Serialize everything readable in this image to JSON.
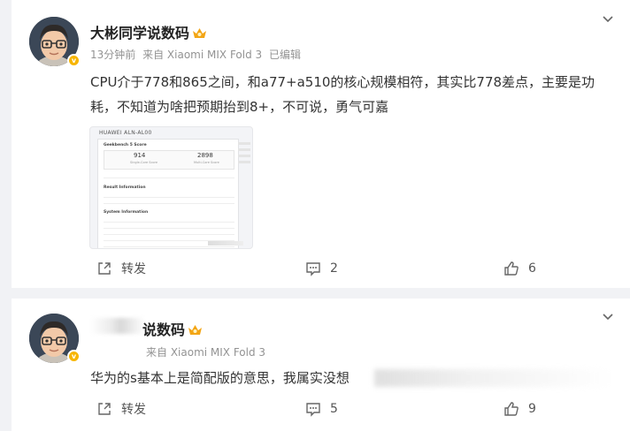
{
  "posts": [
    {
      "author": "大彬同学说数码",
      "time": "13分钟前",
      "source": "来自 Xiaomi MIX Fold 3",
      "edited": "已编辑",
      "text": "CPU介于778和865之间，和a77+a510的核心规模相符，其实比778差点，主要是功耗，不知道为啥把预期抬到8+，不可说，勇气可嘉",
      "share_label": "转发",
      "comments": "2",
      "likes": "6",
      "image": {
        "device": "HUAWEI ALN-AL00",
        "section1": "Geekbench 5 Score",
        "score1": "914",
        "score1_label": "Single-Core Score",
        "score2": "2898",
        "score2_label": "Multi-Core Score",
        "section2": "Result Information",
        "section3": "System Information"
      }
    },
    {
      "author_visible": "说数码",
      "source": "来自 Xiaomi MIX Fold 3",
      "text": "华为的s基本上是简配版的意思，我属实没想",
      "share_label": "转发",
      "comments": "5",
      "likes": "9"
    }
  ],
  "colors": {
    "badge": "#f7b500",
    "background": "#f1f2f5",
    "card": "#ffffff",
    "meta": "#939393"
  },
  "icons": [
    "avatar-memoji",
    "crown-badge-icon",
    "chevron-down-icon",
    "share-icon",
    "comment-icon",
    "like-icon"
  ]
}
